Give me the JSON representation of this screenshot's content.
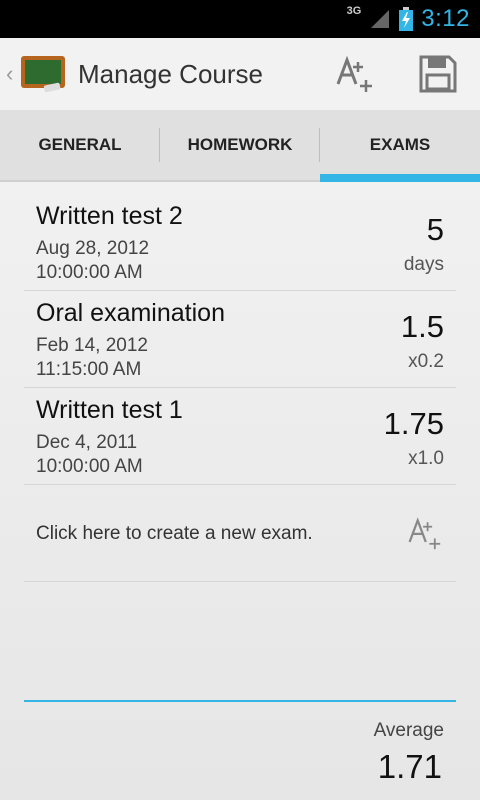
{
  "status_bar": {
    "network": "3G",
    "time": "3:12",
    "icons": [
      "signal-icon",
      "battery-charging-icon"
    ]
  },
  "action_bar": {
    "title": "Manage Course",
    "icons": [
      "chalkboard-app-icon",
      "add-grade-icon",
      "save-icon"
    ]
  },
  "tabs": [
    {
      "label": "GENERAL"
    },
    {
      "label": "HOMEWORK"
    },
    {
      "label": "EXAMS",
      "selected": true
    }
  ],
  "exams": [
    {
      "name": "Written test 2",
      "date": "Aug 28, 2012",
      "time": "10:00:00 AM",
      "value": "5",
      "sub": "days"
    },
    {
      "name": "Oral examination",
      "date": "Feb 14, 2012",
      "time": "11:15:00 AM",
      "value": "1.5",
      "sub": "x0.2"
    },
    {
      "name": "Written test 1",
      "date": "Dec 4, 2011",
      "time": "10:00:00 AM",
      "value": "1.75",
      "sub": "x1.0"
    }
  ],
  "create": {
    "label": "Click here to create a new exam."
  },
  "footer": {
    "average_label": "Average",
    "average_value": "1.71"
  },
  "colors": {
    "accent": "#33b5e5",
    "status_bar_bg": "#000000",
    "tab_bg": "#e0e0e0"
  }
}
